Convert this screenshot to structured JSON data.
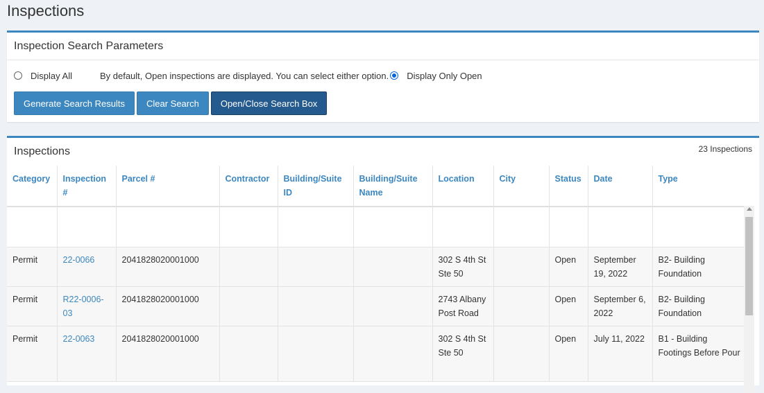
{
  "page": {
    "title": "Inspections"
  },
  "search": {
    "title": "Inspection Search Parameters",
    "display_all_label": "Display All",
    "hint": "By default, Open inspections are displayed. You can select either option.",
    "display_open_label": "Display Only Open",
    "selected_option": "Display Only Open",
    "buttons": {
      "generate": "Generate Search Results",
      "clear": "Clear Search",
      "toggle": "Open/Close Search Box"
    }
  },
  "results": {
    "title": "Inspections",
    "count": "23 Inspections",
    "columns": [
      "Category",
      "Inspection #",
      "Parcel #",
      "Contractor",
      "Building/Suite ID",
      "Building/Suite Name",
      "Location",
      "City",
      "Status",
      "Date",
      "Type"
    ],
    "rows": [
      {
        "category": "Permit",
        "inspection": "22-0066",
        "parcel": "2041828020001000",
        "contractor": "",
        "bsid": "",
        "bsname": "",
        "location": "302 S 4th St Ste 50",
        "city": "",
        "status": "Open",
        "date": "September 19, 2022",
        "type": "B2- Building Foundation"
      },
      {
        "category": "Permit",
        "inspection": "R22-0006-03",
        "parcel": "2041828020001000",
        "contractor": "",
        "bsid": "",
        "bsname": "",
        "location": "2743 Albany Post Road",
        "city": "",
        "status": "Open",
        "date": "September 6, 2022",
        "type": "B2- Building Foundation"
      },
      {
        "category": "Permit",
        "inspection": "22-0063",
        "parcel": "2041828020001000",
        "contractor": "",
        "bsid": "",
        "bsname": "",
        "location": "302 S 4th St Ste 50",
        "city": "",
        "status": "Open",
        "date": "July 11, 2022",
        "type": "B1 - Building Footings Before Pour"
      }
    ]
  }
}
